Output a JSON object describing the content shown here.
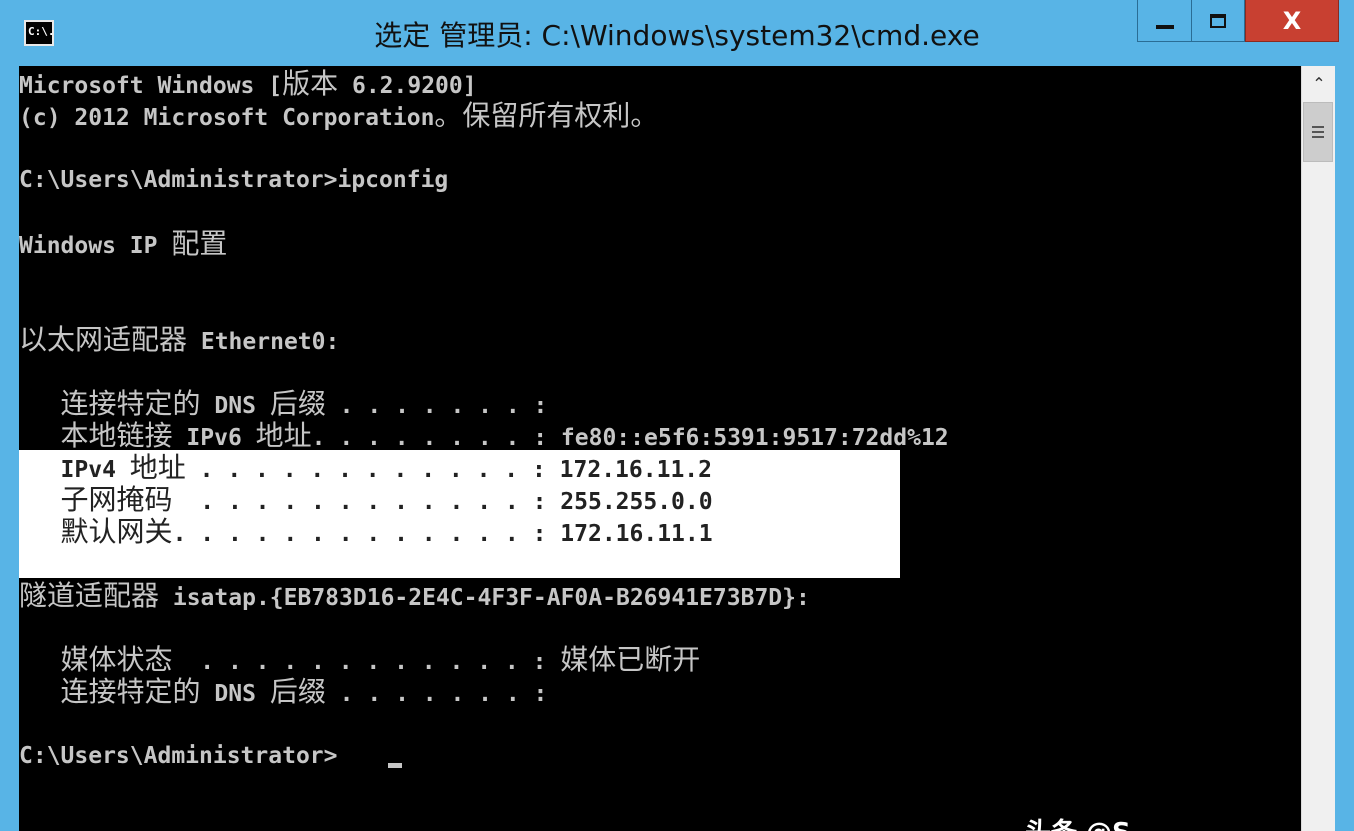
{
  "window": {
    "app_icon_text": "C:\\.",
    "title": "选定 管理员: C:\\Windows\\system32\\cmd.exe",
    "minimize_icon": "minimize-icon",
    "maximize_icon": "maximize-icon",
    "close_glyph": "X"
  },
  "console": {
    "lines": [
      {
        "prefix": "Microsoft Windows [",
        "cjk": "版本",
        "suffix": " 6.2.9200]"
      },
      {
        "prefix": "(c) 2012 Microsoft Corporation",
        "cjk": "。保留所有权利。",
        "suffix": ""
      },
      {
        "text": "C:\\Users\\Administrator>ipconfig"
      },
      {
        "prefix": "Windows IP ",
        "cjk": "配置",
        "suffix": ""
      },
      {
        "prefix": "",
        "cjk": "以太网适配器",
        "suffix": " Ethernet0:"
      },
      {
        "prefix": "   ",
        "cjk": "连接特定的",
        "mid": " DNS ",
        "cjk2": "后缀",
        "suffix": " . . . . . . . :"
      },
      {
        "prefix": "   ",
        "cjk": "本地链接",
        "mid": " IPv6 ",
        "cjk2": "地址",
        "suffix": ". . . . . . . . : fe80::e5f6:5391:9517:72dd%12"
      },
      {
        "prefix": "   IPv4 ",
        "cjk": "地址",
        "suffix": " . . . . . . . . . . . . : 172.16.11.2"
      },
      {
        "prefix": "   ",
        "cjk": "子网掩码",
        "suffix": "  . . . . . . . . . . . . : 255.255.0.0"
      },
      {
        "prefix": "   ",
        "cjk": "默认网关",
        "suffix": ". . . . . . . . . . . . . : 172.16.11.1"
      },
      {
        "prefix": "",
        "cjk": "隧道适配器",
        "suffix": " isatap.{EB783D16-2E4C-4F3F-AF0A-B26941E73B7D}:"
      },
      {
        "prefix": "   ",
        "cjk": "媒体状态",
        "suffix": "  . . . . . . . . . . . . : ",
        "cjk_end": "媒体已断开"
      },
      {
        "prefix": "   ",
        "cjk": "连接特定的",
        "mid": " DNS ",
        "cjk2": "后缀",
        "suffix": " . . . . . . . :"
      },
      {
        "text": "C:\\Users\\Administrator>"
      }
    ]
  },
  "watermark": "头条 @S"
}
